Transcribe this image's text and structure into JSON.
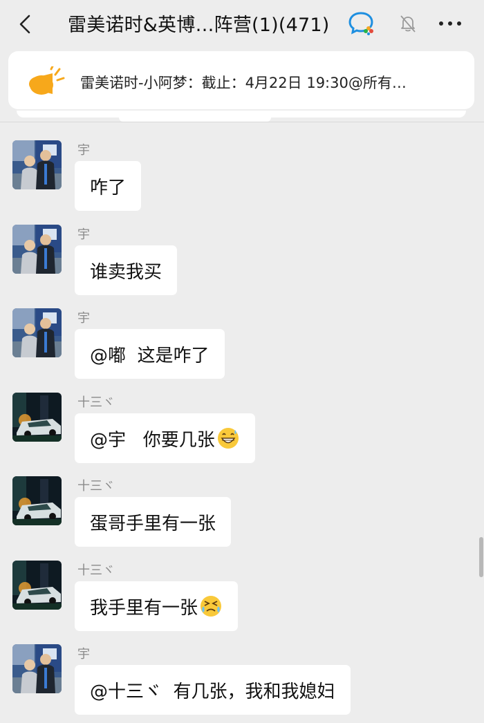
{
  "header": {
    "title": "雷美诺时&英博…阵营(1)(471)",
    "back_icon": "chevron-left-icon",
    "group_icon": "wecom-chat-icon",
    "mute_icon": "bell-muted-icon",
    "more_icon": "more-dots-icon"
  },
  "pinned": {
    "text": "雷美诺时-小阿梦：截止：4月22日 19:30@所有…",
    "icon": "announcement-speaker-icon"
  },
  "messages": [
    {
      "sender": "宇",
      "text": "咋了",
      "avatar": "couple-photo"
    },
    {
      "sender": "宇",
      "text": "谁卖我买",
      "avatar": "couple-photo"
    },
    {
      "sender": "宇",
      "text": "@嘟  这是咋了",
      "avatar": "couple-photo"
    },
    {
      "sender": "十三ヾ",
      "text": "@宇   你要几张",
      "emoji": "grinning-sweat-emoji",
      "avatar": "car-night-photo"
    },
    {
      "sender": "十三ヾ",
      "text": "蛋哥手里有一张",
      "avatar": "car-night-photo"
    },
    {
      "sender": "十三ヾ",
      "text": "我手里有一张",
      "emoji": "crying-squint-emoji",
      "avatar": "car-night-photo"
    },
    {
      "sender": "宇",
      "text": "@十三ヾ  有几张，我和我媳妇",
      "avatar": "couple-photo"
    }
  ],
  "colors": {
    "background": "#ededed",
    "bubble": "#ffffff",
    "sender_name": "#8a8a8a",
    "accent_orange": "#f5a623"
  }
}
